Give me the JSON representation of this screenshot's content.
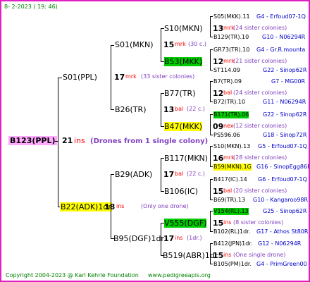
{
  "header": {
    "date": "8-  2-2023 ( 19: 46)"
  },
  "root": {
    "id": "B123(PPL)",
    "num": "21",
    "unit": "ins",
    "note": "(Drones from 1 single colony)"
  },
  "gen1": [
    {
      "id": "S01(PPL)",
      "num": "17",
      "unit": "mrk",
      "note": "(33 sister colonies)"
    },
    {
      "id": "B22(ADK)1dr",
      "num": "18",
      "unit": "ins",
      "note": "(Only one drone)"
    }
  ],
  "gen2": [
    {
      "id": "S01(MKN)",
      "num": "15",
      "unit": "mrk",
      "note": "(30 c.)"
    },
    {
      "id": "B26(TR)",
      "num": "13",
      "unit": "bal",
      "note": "(22 c.)"
    },
    {
      "id": "B29(ADK)",
      "num": "17",
      "unit": "bal",
      "note": "(22 c.)"
    },
    {
      "id": "B95(DGF)1dr",
      "num": "17",
      "unit": "ins",
      "note": "(1dr.)"
    }
  ],
  "gen3": [
    {
      "id": "S10(MKN)",
      "num": "13",
      "unit": "mrk",
      "note": "(24 sister colonies)"
    },
    {
      "id": "B53(MKK)",
      "num": "12",
      "unit": "mrk",
      "note": "(21 sister colonies)"
    },
    {
      "id": "B77(TR)",
      "num": "12",
      "unit": "bal",
      "note": "(24 sister colonies)"
    },
    {
      "id": "B47(MKK)",
      "num": "09",
      "unit": "nex",
      "note": "(12 sister colonies)"
    },
    {
      "id": "B117(MKN)",
      "num": "16",
      "unit": "mrk",
      "note": "(28 sister colonies)"
    },
    {
      "id": "B106(IC)",
      "num": "15",
      "unit": "bal",
      "note": "(20 sister colonies)"
    },
    {
      "id": "V555(DGF)",
      "num": "15",
      "unit": "ins",
      "note": "(8 sister colonies)"
    },
    {
      "id": "B519(ABR)1dr",
      "num": "15",
      "unit": "ins",
      "note": "(One single drone)"
    }
  ],
  "gen4": [
    {
      "left": "S05(MKK).11",
      "right": "G4 - Erfoud07-1Q"
    },
    {
      "left": "B129(TR).10",
      "right": "G10 - N06294R"
    },
    {
      "left": "GR73(TR).10",
      "right": "G4 - Gr.R.mounta"
    },
    {
      "left": "ST114.09",
      "right": "G22 - Sinop62R"
    },
    {
      "left": "B7(TR).09",
      "right": "G7 - MG00R"
    },
    {
      "left": "B72(TR).10",
      "right": "G11 - N06294R"
    },
    {
      "left": "B171(TR).06",
      "right": "G22 - Sinop62R"
    },
    {
      "left": "PS596.06",
      "right": "G18 - Sinop72R"
    },
    {
      "left": "S10(MKN).13",
      "right": "G5 - Erfoud07-1Q"
    },
    {
      "left": "B59(MKN).1G",
      "right": "G16 - SinopEgg86R"
    },
    {
      "left": "B417(IC).14",
      "right": "G6 - Erfoud07-1Q"
    },
    {
      "left": "B69(TR).13",
      "right": "G10 - Kangaroo98R"
    },
    {
      "left": "V154(RL).13",
      "right": "G25 - Sinop62R"
    },
    {
      "left": "B102(RL)1dr.",
      "right": "G17 - Athos St80R"
    },
    {
      "left": "B412(JPN)1dr.",
      "right": "G12 - N06294R"
    },
    {
      "left": "B105(PM)1dr.",
      "right": "G4 - PrimGreen00"
    }
  ],
  "footer": {
    "copyright": "Copyright 2004-2023 @ Karl Kehrle Foundation",
    "url": "www.pedigreeapis.org"
  },
  "colors": {
    "border": "#e020c0",
    "root_highlight": "#ffaaff",
    "yellow": "#ffff00",
    "green": "#00cc00",
    "blue": "#0000cc",
    "purple": "#8040c0",
    "red": "#ff0000",
    "footer": "#008000"
  }
}
